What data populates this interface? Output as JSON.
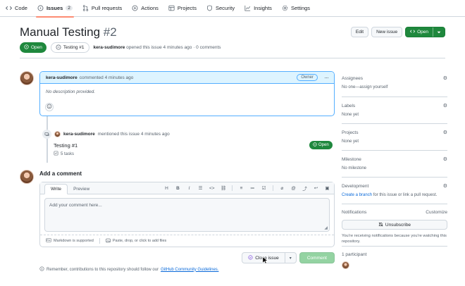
{
  "nav": {
    "tabs": [
      {
        "label": "Code",
        "icon": "code-icon"
      },
      {
        "label": "Issues",
        "count": "2",
        "icon": "issue-icon",
        "active": true
      },
      {
        "label": "Pull requests",
        "icon": "pull-request-icon"
      },
      {
        "label": "Actions",
        "icon": "play-icon"
      },
      {
        "label": "Projects",
        "icon": "table-icon"
      },
      {
        "label": "Security",
        "icon": "shield-icon"
      },
      {
        "label": "Insights",
        "icon": "graph-icon"
      },
      {
        "label": "Settings",
        "icon": "gear-icon"
      }
    ]
  },
  "issue": {
    "title": "Manual Testing",
    "number": "#2",
    "state": "Open",
    "tracked_in": "Testing #1",
    "author": "kera-sudimore",
    "meta_rest": "opened this issue 4 minutes ago · 0 comments",
    "edit_label": "Edit",
    "new_issue_label": "New issue",
    "open_label": "Open"
  },
  "comment": {
    "author": "kera-sudimore",
    "time": "commented 4 minutes ago",
    "badge": "Owner",
    "body": "No description provided."
  },
  "event": {
    "author": "kera-sudimore",
    "text": "mentioned this issue 4 minutes ago",
    "ref_title": "Testing #1",
    "ref_tasks": "5 tasks",
    "ref_state": "Open"
  },
  "composer": {
    "title": "Add a comment",
    "tab_write": "Write",
    "tab_preview": "Preview",
    "placeholder": "Add your comment here...",
    "markdown_note": "Markdown is supported",
    "attach_note": "Paste, drop, or click to add files",
    "close_label": "Close issue",
    "comment_label": "Comment"
  },
  "footer_note": {
    "text": "Remember, contributions to this repository should follow our",
    "link": "GitHub Community Guidelines."
  },
  "sidebar": {
    "assignees": {
      "title": "Assignees",
      "value": "No one—assign yourself"
    },
    "labels": {
      "title": "Labels",
      "value": "None yet"
    },
    "projects": {
      "title": "Projects",
      "value": "None yet"
    },
    "milestone": {
      "title": "Milestone",
      "value": "No milestone"
    },
    "development": {
      "title": "Development",
      "link": "Create a branch",
      "rest": "for this issue or link a pull request."
    },
    "notifications": {
      "title": "Notifications",
      "customize": "Customize",
      "button": "Unsubscribe",
      "note": "You're receiving notifications because you're watching this repository."
    },
    "participants": {
      "title": "1 participant"
    }
  },
  "colors": {
    "green": "#1f883d",
    "blue": "#0969da",
    "highlight": "#ddf4ff",
    "tab_accent": "#fd8c73"
  }
}
